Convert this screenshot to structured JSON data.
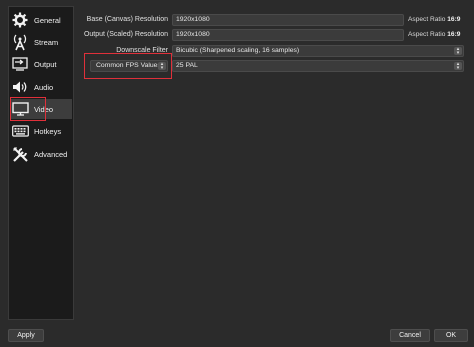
{
  "sidebar": {
    "items": [
      {
        "label": "General",
        "icon": "gear-icon"
      },
      {
        "label": "Stream",
        "icon": "antenna-icon"
      },
      {
        "label": "Output",
        "icon": "output-icon"
      },
      {
        "label": "Audio",
        "icon": "speaker-icon"
      },
      {
        "label": "Video",
        "icon": "monitor-icon",
        "selected": true
      },
      {
        "label": "Hotkeys",
        "icon": "keyboard-icon"
      },
      {
        "label": "Advanced",
        "icon": "tools-icon"
      }
    ]
  },
  "video": {
    "base_resolution": {
      "label": "Base (Canvas) Resolution",
      "value": "1920x1080",
      "aspect_label": "Aspect Ratio",
      "aspect_value": "16:9"
    },
    "output_resolution": {
      "label": "Output (Scaled) Resolution",
      "value": "1920x1080",
      "aspect_label": "Aspect Ratio",
      "aspect_value": "16:9"
    },
    "downscale_filter": {
      "label": "Downscale Filter",
      "value": "Bicubic (Sharpened scaling, 16 samples)"
    },
    "fps": {
      "type_value": "Common FPS Values",
      "value": "25 PAL"
    }
  },
  "footer": {
    "apply_label": "Apply",
    "cancel_label": "Cancel",
    "ok_label": "OK"
  },
  "colors": {
    "background": "#2b2b2b",
    "sidebar": "#1b1b1b",
    "highlight": "#e0303a"
  }
}
